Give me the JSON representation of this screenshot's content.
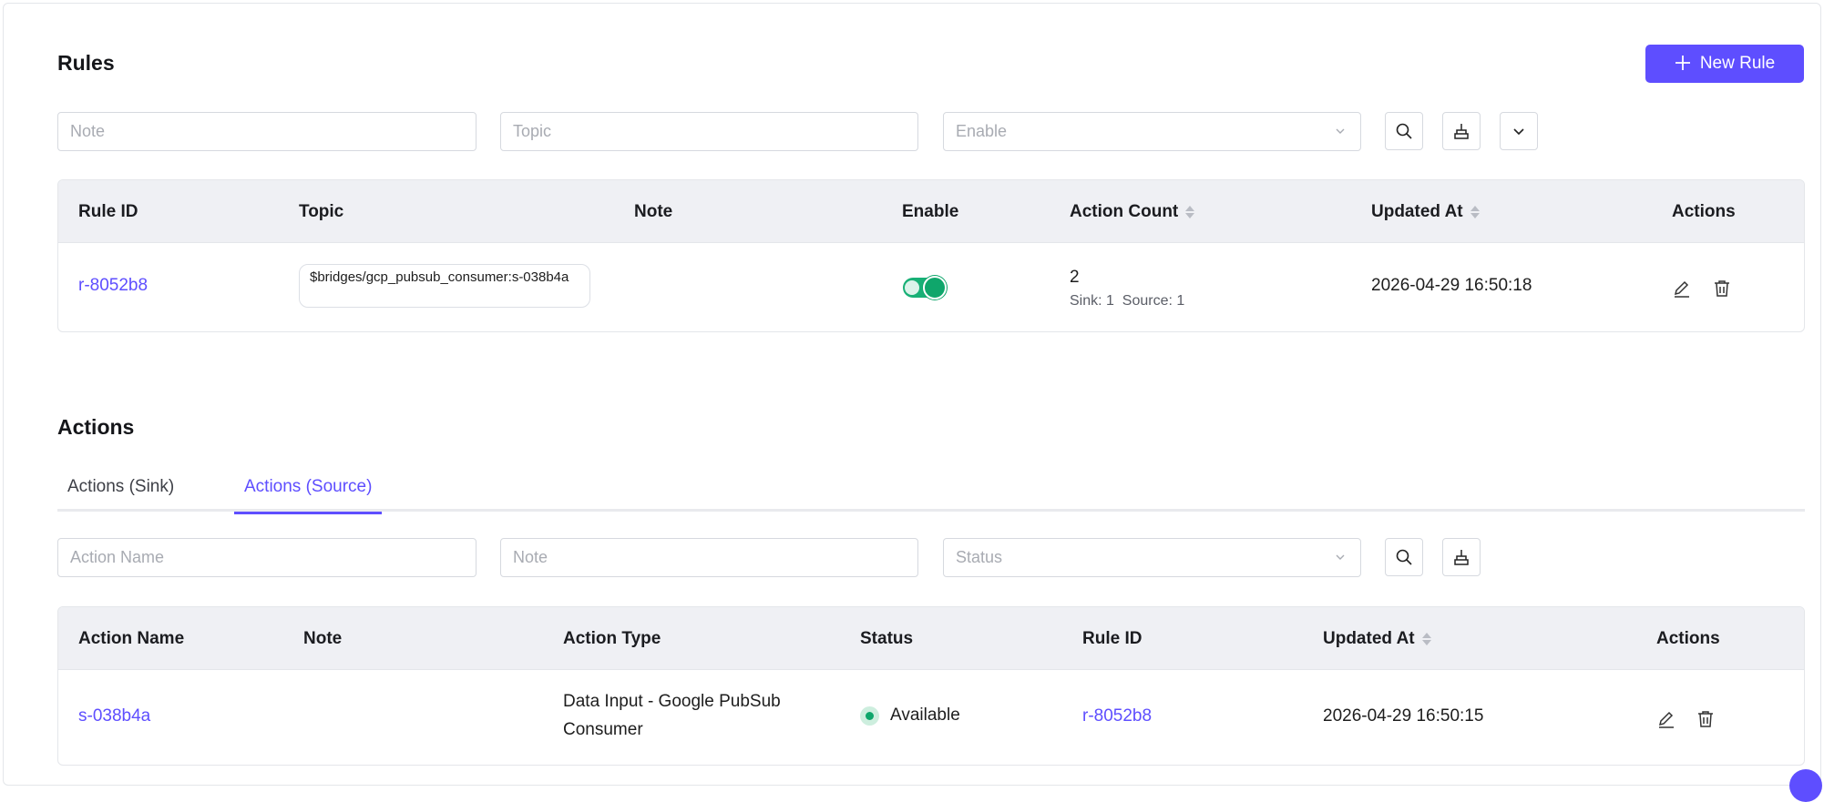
{
  "rules": {
    "title": "Rules",
    "new_rule_label": "New Rule",
    "filters": {
      "note_placeholder": "Note",
      "topic_placeholder": "Topic",
      "enable_placeholder": "Enable"
    },
    "columns": [
      "Rule ID",
      "Topic",
      "Note",
      "Enable",
      "Action Count",
      "Updated At",
      "Actions"
    ],
    "rows": [
      {
        "rule_id": "r-8052b8",
        "topic": "$bridges/gcp_pubsub_consumer:s-038b4a",
        "note": "",
        "enabled": true,
        "action_count": "2",
        "action_detail": "Sink: 1  Source: 1",
        "updated_at": "2026-04-29 16:50:18"
      }
    ]
  },
  "actions": {
    "title": "Actions",
    "tabs": [
      "Actions (Sink)",
      "Actions (Source)"
    ],
    "active_tab": "Actions (Source)",
    "filters": {
      "name_placeholder": "Action Name",
      "note_placeholder": "Note",
      "status_placeholder": "Status"
    },
    "columns": [
      "Action Name",
      "Note",
      "Action Type",
      "Status",
      "Rule ID",
      "Updated At",
      "Actions"
    ],
    "rows": [
      {
        "name": "s-038b4a",
        "note": "",
        "type_line1": "Data Input - Google PubSub",
        "type_line2": "Consumer",
        "status": "Available",
        "rule_id": "r-8052b8",
        "updated_at": "2026-04-29 16:50:15"
      }
    ]
  },
  "colors": {
    "accent": "#5e4eff",
    "success": "#0fa66b",
    "header_bg": "#eff0f4"
  },
  "icons": [
    "plus-icon",
    "search-icon",
    "clear-filter-icon",
    "chevron-down-icon",
    "edit-icon",
    "delete-icon",
    "sort-icon"
  ]
}
